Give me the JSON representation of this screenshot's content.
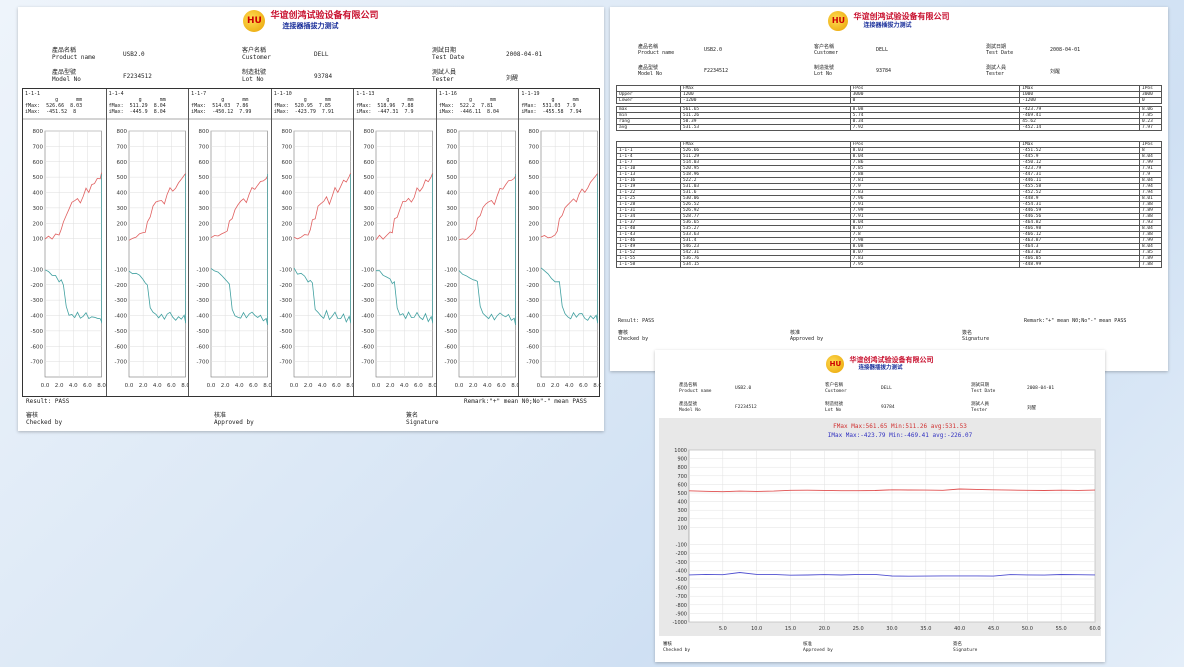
{
  "company": {
    "name": "华谊创鸿试验设备有限公司",
    "test_name": "连接器插拔力测试",
    "logo_text": "HU"
  },
  "labels": {
    "product_cn": "產品名稱",
    "product_en": "Product name",
    "model_cn": "產品型號",
    "model_en": "Model No",
    "customer_cn": "客户名稱",
    "customer_en": "Customer",
    "lot_cn": "制造批號",
    "lot_en": "Lot No",
    "date_cn": "測試日期",
    "date_en": "Test Date",
    "tester_cn": "測試人員",
    "tester_en": "Tester",
    "checked_cn": "審核",
    "checked_en": "Checked by",
    "approved_cn": "核准",
    "approved_en": "Approved by",
    "signature_cn": "簽名",
    "signature_en": "Signature"
  },
  "info": {
    "product": "USB2.0",
    "model": "F2234512",
    "customer": "DELL",
    "lot": "93784",
    "date": "2008-04-01",
    "tester": "刘醒"
  },
  "report1": {
    "result": "Result:  PASS",
    "remark": "Remark:\"+\" mean N0;No\"-\" mean PASS",
    "panels": [
      {
        "id": "1-1-1",
        "fmax": "526.66",
        "fmax_mm": "8.03",
        "fmin": "-451.52",
        "fmin_mm": "8"
      },
      {
        "id": "1-1-4",
        "fmax": "511.29",
        "fmax_mm": "8.04",
        "fmin": "-445.9",
        "fmin_mm": "8.04"
      },
      {
        "id": "1-1-7",
        "fmax": "514.03",
        "fmax_mm": "7.86",
        "fmin": "-450.12",
        "fmin_mm": "7.99"
      },
      {
        "id": "1-1-10",
        "fmax": "520.95",
        "fmax_mm": "7.85",
        "fmin": "-423.79",
        "fmin_mm": "7.91"
      },
      {
        "id": "1-1-13",
        "fmax": "518.96",
        "fmax_mm": "7.88",
        "fmin": "-447.31",
        "fmin_mm": "7.9"
      },
      {
        "id": "1-1-16",
        "fmax": "522.2",
        "fmax_mm": "7.81",
        "fmin": "-446.11",
        "fmin_mm": "8.04"
      },
      {
        "id": "1-1-19",
        "fmax": "531.03",
        "fmax_mm": "7.9",
        "fmin": "-455.58",
        "fmin_mm": "7.94"
      }
    ],
    "unit_label": "g",
    "mm_label": "mm",
    "fmax_label": "Max:",
    "fmin_label": "Max:",
    "y_ticks": [
      "800",
      "700",
      "600",
      "500",
      "400",
      "300",
      "200",
      "100",
      "-100",
      "-200",
      "-300",
      "-400",
      "-500",
      "-600",
      "-700"
    ],
    "x_ticks": [
      "0.0",
      "2.0",
      "4.0",
      "6.0",
      "8.0"
    ]
  },
  "report2": {
    "header_row": [
      "",
      "FMax",
      "FPos",
      "IMax",
      "IPos"
    ],
    "limits": [
      [
        "Upper",
        "1200",
        "3000",
        "1000",
        "3000"
      ],
      [
        "Lower",
        "-1200",
        "0",
        "-1200",
        "0"
      ]
    ],
    "stats": [
      [
        "max",
        "561.65",
        "8.08",
        "-423.79",
        "8.06"
      ],
      [
        "min",
        "511.26",
        "5.74",
        "-469.41",
        "7.85"
      ],
      [
        "rang",
        "50.39",
        "0.34",
        "45.62",
        "0.23"
      ],
      [
        "avg",
        "531.53",
        "7.92",
        "-452.14",
        "7.97"
      ]
    ],
    "rows": [
      [
        "1-1-1",
        "526.66",
        "8.03",
        "-451.52",
        "8"
      ],
      [
        "1-1-4",
        "511.29",
        "8.04",
        "-445.9",
        "8.04"
      ],
      [
        "1-1-7",
        "514.03",
        "7.86",
        "-450.12",
        "7.99"
      ],
      [
        "1-1-10",
        "520.95",
        "7.85",
        "-423.79",
        "7.91"
      ],
      [
        "1-1-13",
        "518.96",
        "7.88",
        "-447.31",
        "7.9"
      ],
      [
        "1-1-16",
        "522.2",
        "7.81",
        "-446.11",
        "8.04"
      ],
      [
        "1-1-19",
        "531.03",
        "7.9",
        "-455.58",
        "7.94"
      ],
      [
        "1-1-22",
        "531.6",
        "7.83",
        "-452.52",
        "7.94"
      ],
      [
        "1-1-25",
        "530.06",
        "7.96",
        "-448.9",
        "8.01"
      ],
      [
        "1-1-28",
        "526.52",
        "7.91",
        "-454.31",
        "7.88"
      ],
      [
        "1-1-31",
        "526.92",
        "7.99",
        "-446.59",
        "7.89"
      ],
      [
        "1-1-34",
        "528.77",
        "7.91",
        "-446.56",
        "7.88"
      ],
      [
        "1-1-37",
        "536.65",
        "8.04",
        "-464.82",
        "7.93"
      ],
      [
        "1-1-40",
        "535.27",
        "8.07",
        "-466.98",
        "8.04"
      ],
      [
        "1-1-43",
        "533.63",
        "7.8",
        "-466.12",
        "7.88"
      ],
      [
        "1-1-46",
        "531.4",
        "7.98",
        "-463.87",
        "7.99"
      ],
      [
        "1-1-49",
        "546.23",
        "8.08",
        "-464.3",
        "8.04"
      ],
      [
        "1-1-52",
        "542.31",
        "8.07",
        "-463.82",
        "7.85"
      ],
      [
        "1-1-55",
        "536.76",
        "7.83",
        "-466.05",
        "7.89"
      ],
      [
        "1-1-58",
        "534.15",
        "7.95",
        "-448.99",
        "7.88"
      ]
    ],
    "result": "Result:  PASS",
    "remark": "Remark:\"+\" mean N0;No\"-\" mean PASS"
  },
  "report3": {
    "legend_line1": "FMax  Max:561.65 Min:511.26  avg:531.53",
    "legend_line2": "IMax  Max:-423.79 Min:-469.41  avg:-226.07"
  },
  "chart_data": [
    {
      "type": "line",
      "title": "",
      "xlabel": "",
      "ylabel": "",
      "x": [
        0,
        0.5,
        1,
        1.5,
        2,
        2.3,
        2.6,
        3,
        3.4,
        3.8,
        4.2,
        4.6,
        5,
        5.4,
        5.8,
        6.2,
        6.6,
        7,
        7.4,
        7.8,
        8
      ],
      "series": [
        {
          "color": "#e06060",
          "values": [
            100,
            110,
            105,
            120,
            135,
            150,
            220,
            240,
            300,
            330,
            350,
            360,
            330,
            380,
            420,
            410,
            440,
            470,
            480,
            500,
            520
          ]
        },
        {
          "color": "#40a0a0",
          "values": [
            -100,
            -120,
            -130,
            -150,
            -170,
            -180,
            -190,
            -350,
            -390,
            -400,
            -410,
            -380,
            -420,
            -400,
            -390,
            -410,
            -420,
            -400,
            -430,
            -410,
            -450
          ]
        }
      ],
      "ylim": [
        -800,
        800
      ],
      "xlim": [
        0,
        8
      ]
    },
    {
      "type": "line",
      "title": "",
      "xlabel": "",
      "ylabel": "",
      "x": [
        0,
        2.5,
        5,
        7.5,
        10,
        12.5,
        15,
        17.5,
        20,
        22.5,
        25,
        27.5,
        30,
        32.5,
        35,
        37.5,
        40,
        42.5,
        45,
        47.5,
        50,
        52.5,
        55,
        57.5,
        60
      ],
      "series": [
        {
          "name": "FMax",
          "color": "#e05050",
          "values": [
            526,
            520,
            515,
            522,
            519,
            522,
            531,
            532,
            530,
            527,
            527,
            529,
            537,
            535,
            534,
            531,
            546,
            542,
            537,
            534,
            531,
            529,
            533,
            530,
            534
          ]
        },
        {
          "name": "IMax",
          "color": "#5050d0",
          "values": [
            -452,
            -446,
            -450,
            -424,
            -447,
            -446,
            -456,
            -453,
            -449,
            -454,
            -447,
            -447,
            -465,
            -467,
            -466,
            -464,
            -464,
            -464,
            -466,
            -449,
            -452,
            -455,
            -448,
            -450,
            -452
          ]
        }
      ],
      "ylim": [
        -1000,
        1000
      ],
      "xlim": [
        0,
        60
      ],
      "y_ticks": [
        1000,
        900,
        800,
        700,
        600,
        500,
        400,
        300,
        200,
        100,
        -100,
        -200,
        -300,
        -400,
        -500,
        -600,
        -700,
        -800,
        -900,
        -1000
      ],
      "x_ticks": [
        "5.0",
        "10.0",
        "15.0",
        "20.0",
        "25.0",
        "30.0",
        "35.0",
        "40.0",
        "45.0",
        "50.0",
        "55.0",
        "60.0"
      ]
    }
  ]
}
